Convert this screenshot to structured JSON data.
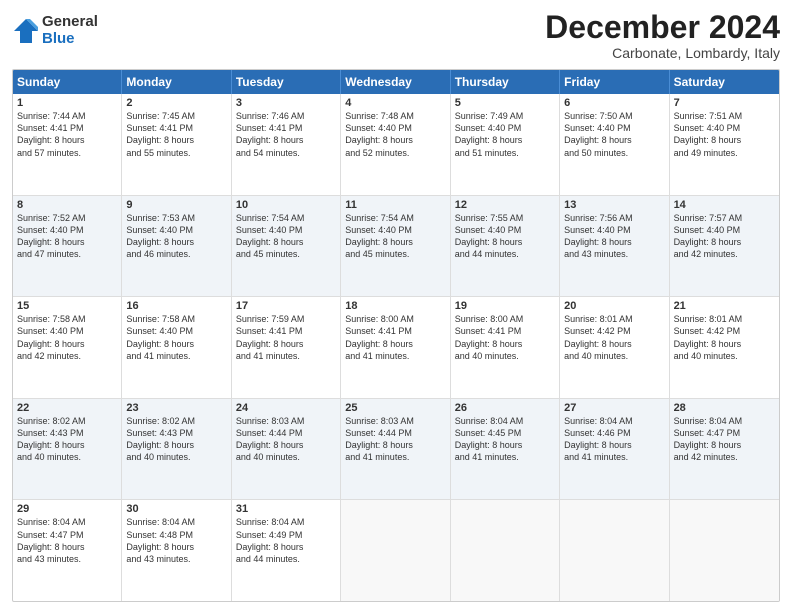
{
  "logo": {
    "general": "General",
    "blue": "Blue"
  },
  "title": "December 2024",
  "subtitle": "Carbonate, Lombardy, Italy",
  "days": [
    "Sunday",
    "Monday",
    "Tuesday",
    "Wednesday",
    "Thursday",
    "Friday",
    "Saturday"
  ],
  "rows": [
    {
      "shaded": false,
      "cells": [
        {
          "day": "1",
          "lines": [
            "Sunrise: 7:44 AM",
            "Sunset: 4:41 PM",
            "Daylight: 8 hours",
            "and 57 minutes."
          ]
        },
        {
          "day": "2",
          "lines": [
            "Sunrise: 7:45 AM",
            "Sunset: 4:41 PM",
            "Daylight: 8 hours",
            "and 55 minutes."
          ]
        },
        {
          "day": "3",
          "lines": [
            "Sunrise: 7:46 AM",
            "Sunset: 4:41 PM",
            "Daylight: 8 hours",
            "and 54 minutes."
          ]
        },
        {
          "day": "4",
          "lines": [
            "Sunrise: 7:48 AM",
            "Sunset: 4:40 PM",
            "Daylight: 8 hours",
            "and 52 minutes."
          ]
        },
        {
          "day": "5",
          "lines": [
            "Sunrise: 7:49 AM",
            "Sunset: 4:40 PM",
            "Daylight: 8 hours",
            "and 51 minutes."
          ]
        },
        {
          "day": "6",
          "lines": [
            "Sunrise: 7:50 AM",
            "Sunset: 4:40 PM",
            "Daylight: 8 hours",
            "and 50 minutes."
          ]
        },
        {
          "day": "7",
          "lines": [
            "Sunrise: 7:51 AM",
            "Sunset: 4:40 PM",
            "Daylight: 8 hours",
            "and 49 minutes."
          ]
        }
      ]
    },
    {
      "shaded": true,
      "cells": [
        {
          "day": "8",
          "lines": [
            "Sunrise: 7:52 AM",
            "Sunset: 4:40 PM",
            "Daylight: 8 hours",
            "and 47 minutes."
          ]
        },
        {
          "day": "9",
          "lines": [
            "Sunrise: 7:53 AM",
            "Sunset: 4:40 PM",
            "Daylight: 8 hours",
            "and 46 minutes."
          ]
        },
        {
          "day": "10",
          "lines": [
            "Sunrise: 7:54 AM",
            "Sunset: 4:40 PM",
            "Daylight: 8 hours",
            "and 45 minutes."
          ]
        },
        {
          "day": "11",
          "lines": [
            "Sunrise: 7:54 AM",
            "Sunset: 4:40 PM",
            "Daylight: 8 hours",
            "and 45 minutes."
          ]
        },
        {
          "day": "12",
          "lines": [
            "Sunrise: 7:55 AM",
            "Sunset: 4:40 PM",
            "Daylight: 8 hours",
            "and 44 minutes."
          ]
        },
        {
          "day": "13",
          "lines": [
            "Sunrise: 7:56 AM",
            "Sunset: 4:40 PM",
            "Daylight: 8 hours",
            "and 43 minutes."
          ]
        },
        {
          "day": "14",
          "lines": [
            "Sunrise: 7:57 AM",
            "Sunset: 4:40 PM",
            "Daylight: 8 hours",
            "and 42 minutes."
          ]
        }
      ]
    },
    {
      "shaded": false,
      "cells": [
        {
          "day": "15",
          "lines": [
            "Sunrise: 7:58 AM",
            "Sunset: 4:40 PM",
            "Daylight: 8 hours",
            "and 42 minutes."
          ]
        },
        {
          "day": "16",
          "lines": [
            "Sunrise: 7:58 AM",
            "Sunset: 4:40 PM",
            "Daylight: 8 hours",
            "and 41 minutes."
          ]
        },
        {
          "day": "17",
          "lines": [
            "Sunrise: 7:59 AM",
            "Sunset: 4:41 PM",
            "Daylight: 8 hours",
            "and 41 minutes."
          ]
        },
        {
          "day": "18",
          "lines": [
            "Sunrise: 8:00 AM",
            "Sunset: 4:41 PM",
            "Daylight: 8 hours",
            "and 41 minutes."
          ]
        },
        {
          "day": "19",
          "lines": [
            "Sunrise: 8:00 AM",
            "Sunset: 4:41 PM",
            "Daylight: 8 hours",
            "and 40 minutes."
          ]
        },
        {
          "day": "20",
          "lines": [
            "Sunrise: 8:01 AM",
            "Sunset: 4:42 PM",
            "Daylight: 8 hours",
            "and 40 minutes."
          ]
        },
        {
          "day": "21",
          "lines": [
            "Sunrise: 8:01 AM",
            "Sunset: 4:42 PM",
            "Daylight: 8 hours",
            "and 40 minutes."
          ]
        }
      ]
    },
    {
      "shaded": true,
      "cells": [
        {
          "day": "22",
          "lines": [
            "Sunrise: 8:02 AM",
            "Sunset: 4:43 PM",
            "Daylight: 8 hours",
            "and 40 minutes."
          ]
        },
        {
          "day": "23",
          "lines": [
            "Sunrise: 8:02 AM",
            "Sunset: 4:43 PM",
            "Daylight: 8 hours",
            "and 40 minutes."
          ]
        },
        {
          "day": "24",
          "lines": [
            "Sunrise: 8:03 AM",
            "Sunset: 4:44 PM",
            "Daylight: 8 hours",
            "and 40 minutes."
          ]
        },
        {
          "day": "25",
          "lines": [
            "Sunrise: 8:03 AM",
            "Sunset: 4:44 PM",
            "Daylight: 8 hours",
            "and 41 minutes."
          ]
        },
        {
          "day": "26",
          "lines": [
            "Sunrise: 8:04 AM",
            "Sunset: 4:45 PM",
            "Daylight: 8 hours",
            "and 41 minutes."
          ]
        },
        {
          "day": "27",
          "lines": [
            "Sunrise: 8:04 AM",
            "Sunset: 4:46 PM",
            "Daylight: 8 hours",
            "and 41 minutes."
          ]
        },
        {
          "day": "28",
          "lines": [
            "Sunrise: 8:04 AM",
            "Sunset: 4:47 PM",
            "Daylight: 8 hours",
            "and 42 minutes."
          ]
        }
      ]
    },
    {
      "shaded": false,
      "cells": [
        {
          "day": "29",
          "lines": [
            "Sunrise: 8:04 AM",
            "Sunset: 4:47 PM",
            "Daylight: 8 hours",
            "and 43 minutes."
          ]
        },
        {
          "day": "30",
          "lines": [
            "Sunrise: 8:04 AM",
            "Sunset: 4:48 PM",
            "Daylight: 8 hours",
            "and 43 minutes."
          ]
        },
        {
          "day": "31",
          "lines": [
            "Sunrise: 8:04 AM",
            "Sunset: 4:49 PM",
            "Daylight: 8 hours",
            "and 44 minutes."
          ]
        },
        {
          "day": "",
          "lines": []
        },
        {
          "day": "",
          "lines": []
        },
        {
          "day": "",
          "lines": []
        },
        {
          "day": "",
          "lines": []
        }
      ]
    }
  ]
}
